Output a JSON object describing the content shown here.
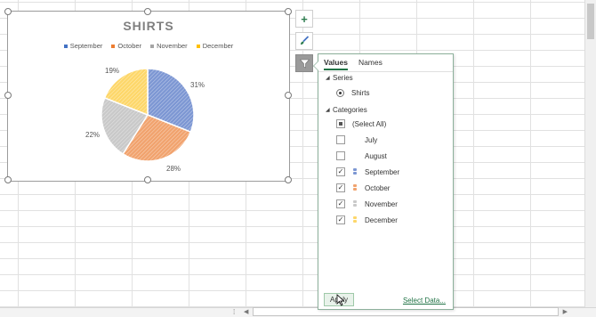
{
  "chart": {
    "title": "SHIRTS",
    "legend": [
      {
        "label": "September",
        "color": "#4472c4"
      },
      {
        "label": "October",
        "color": "#ed7d31"
      },
      {
        "label": "November",
        "color": "#a5a5a5"
      },
      {
        "label": "December",
        "color": "#ffc000"
      }
    ]
  },
  "chart_data": {
    "type": "pie",
    "title": "SHIRTS",
    "categories": [
      "September",
      "October",
      "November",
      "December"
    ],
    "values": [
      31,
      28,
      22,
      19
    ],
    "labels": [
      "31%",
      "28%",
      "22%",
      "19%"
    ],
    "colors": [
      "#7d97d3",
      "#f1a36e",
      "#c9c9c9",
      "#fdd76a"
    ],
    "legend_position": "top"
  },
  "side_buttons": {
    "add": "+",
    "style": "style-brush-icon",
    "filter": "filter-icon"
  },
  "filter_panel": {
    "tabs": [
      "Values",
      "Names"
    ],
    "series_heading": "Series",
    "series_item": "Shirts",
    "categories_heading": "Categories",
    "categories": [
      {
        "label": "(Select All)",
        "state": "partial"
      },
      {
        "label": "July",
        "state": "unchecked"
      },
      {
        "label": "August",
        "state": "unchecked"
      },
      {
        "label": "September",
        "state": "checked",
        "color": "#4472c4"
      },
      {
        "label": "October",
        "state": "checked",
        "color": "#ed7d31"
      },
      {
        "label": "November",
        "state": "checked",
        "color": "#a5a5a5"
      },
      {
        "label": "December",
        "state": "checked",
        "color": "#ffc000"
      }
    ],
    "apply": "Apply",
    "select_data": "Select Data..."
  }
}
